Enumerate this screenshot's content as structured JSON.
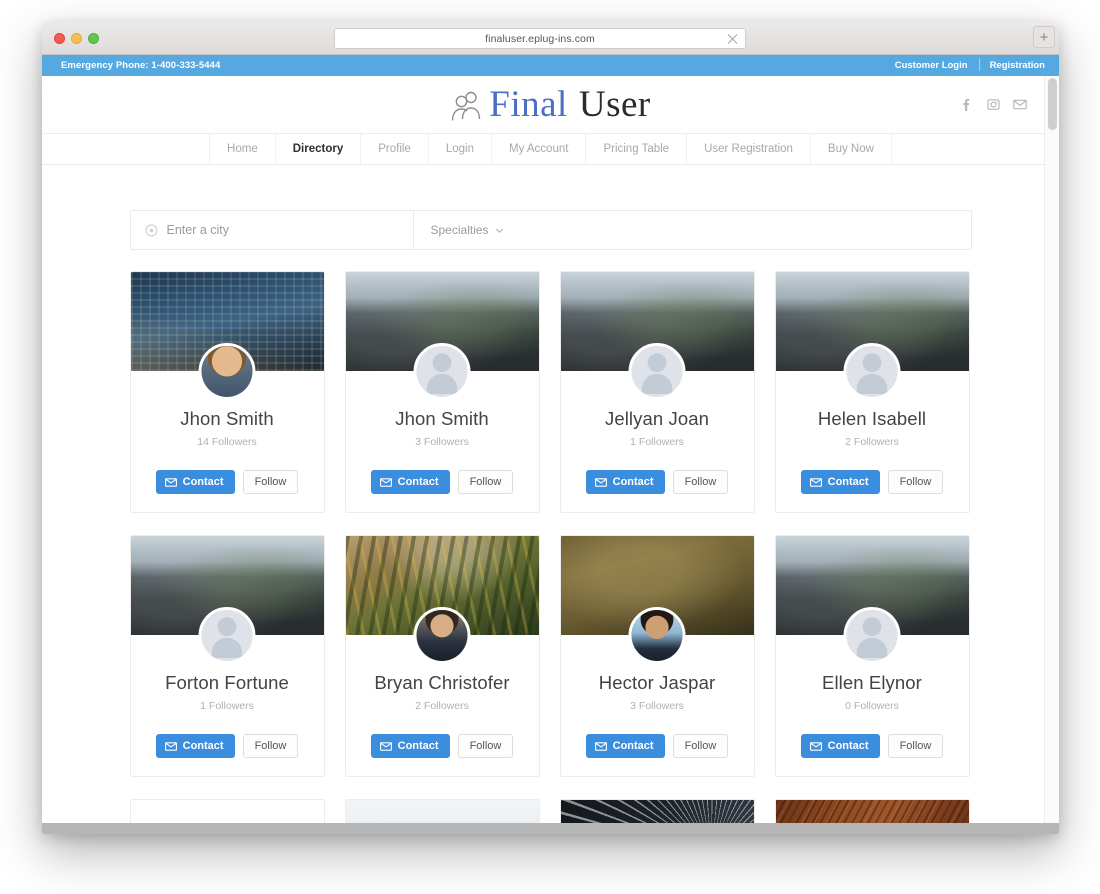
{
  "browser": {
    "url": "finaluser.eplug-ins.com",
    "close_tab_icon": "close-icon",
    "new_tab_label": "+"
  },
  "topbar": {
    "emergency_phone": "Emergency Phone: 1-400-333-5444",
    "links": [
      {
        "label": "Customer Login"
      },
      {
        "label": "Registration"
      }
    ],
    "background_color": "#56a8e0"
  },
  "header": {
    "logo": {
      "icon": "users-icon",
      "word1": "Final",
      "word2": "User",
      "word1_color": "#4a6fc4",
      "word2_color": "#2c2c2c"
    },
    "social": [
      {
        "name": "facebook-icon"
      },
      {
        "name": "instagram-icon"
      },
      {
        "name": "email-icon"
      }
    ]
  },
  "nav": {
    "items": [
      {
        "label": "Home",
        "active": false
      },
      {
        "label": "Directory",
        "active": true
      },
      {
        "label": "Profile",
        "active": false
      },
      {
        "label": "Login",
        "active": false
      },
      {
        "label": "My Account",
        "active": false
      },
      {
        "label": "Pricing Table",
        "active": false
      },
      {
        "label": "User Registration",
        "active": false
      },
      {
        "label": "Buy Now",
        "active": false
      }
    ]
  },
  "search": {
    "city_icon": "location-target-icon",
    "city_placeholder": "Enter a city",
    "city_value": "",
    "specialties_label": "Specialties",
    "specialties_chevron": "chevron-down-icon"
  },
  "buttons": {
    "contact_label": "Contact",
    "contact_icon": "envelope-icon",
    "follow_label": "Follow",
    "contact_color": "#3b8ede"
  },
  "cards": [
    [
      {
        "name": "Jhon Smith",
        "followers": "14 Followers",
        "cover": "city-night",
        "avatar": "photo-man-1"
      },
      {
        "name": "Jhon Smith",
        "followers": "3 Followers",
        "cover": "dark-mountain",
        "avatar": "placeholder"
      },
      {
        "name": "Jellyan Joan",
        "followers": "1 Followers",
        "cover": "dark-mountain",
        "avatar": "placeholder"
      },
      {
        "name": "Helen Isabell",
        "followers": "2 Followers",
        "cover": "dark-mountain",
        "avatar": "placeholder"
      }
    ],
    [
      {
        "name": "Forton Fortune",
        "followers": "1 Followers",
        "cover": "dark-mountain",
        "avatar": "placeholder"
      },
      {
        "name": "Bryan Christofer",
        "followers": "2 Followers",
        "cover": "autumn-forest",
        "avatar": "photo-man-2"
      },
      {
        "name": "Hector Jaspar",
        "followers": "3 Followers",
        "cover": "olive-blur",
        "avatar": "photo-man-3"
      },
      {
        "name": "Ellen Elynor",
        "followers": "0 Followers",
        "cover": "dark-mountain",
        "avatar": "placeholder"
      }
    ],
    [
      {
        "name": "",
        "followers": "",
        "cover": "plain-white",
        "avatar": "none"
      },
      {
        "name": "",
        "followers": "",
        "cover": "snow-field",
        "avatar": "none"
      },
      {
        "name": "",
        "followers": "",
        "cover": "dandelion-dark",
        "avatar": "none"
      },
      {
        "name": "",
        "followers": "",
        "cover": "wood-grain",
        "avatar": "none"
      }
    ]
  ]
}
